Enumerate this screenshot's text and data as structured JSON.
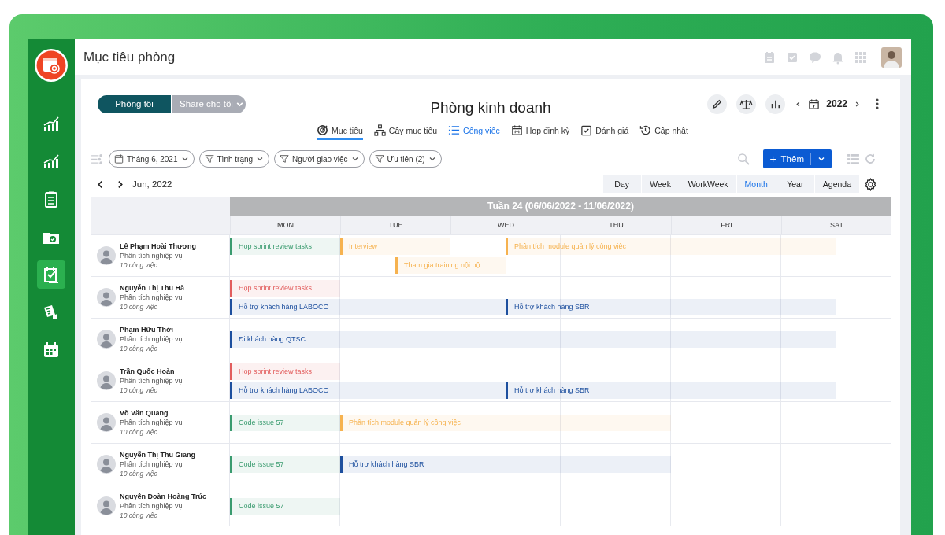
{
  "app": {
    "title": "Mục tiêu phòng"
  },
  "sidebar": {
    "items": [
      {
        "selected": false
      },
      {
        "selected": false
      },
      {
        "selected": false
      },
      {
        "selected": false
      },
      {
        "selected": true
      },
      {
        "selected": false
      },
      {
        "selected": false
      }
    ]
  },
  "scope_toggle": [
    {
      "label": "Phòng tôi",
      "selected": true
    },
    {
      "label": "Share cho tôi",
      "selected": false
    }
  ],
  "page_title": "Phòng kinh doanh",
  "year_nav": {
    "year": "2022"
  },
  "tabs": [
    {
      "label": "Mục tiêu",
      "selected": true,
      "current": false
    },
    {
      "label": "Cây mục tiêu",
      "selected": false,
      "current": false
    },
    {
      "label": "Công việc",
      "selected": false,
      "current": true
    },
    {
      "label": "Họp định kỳ",
      "selected": false,
      "current": false
    },
    {
      "label": "Đánh giá",
      "selected": false,
      "current": false
    },
    {
      "label": "Cập nhật",
      "selected": false,
      "current": false
    }
  ],
  "filters": [
    {
      "label": "Tháng 6, 2021",
      "kind": "date"
    },
    {
      "label": "Tình trạng",
      "kind": "filter"
    },
    {
      "label": "Người giao việc",
      "kind": "filter"
    },
    {
      "label": "Ưu tiên (2)",
      "kind": "filter"
    }
  ],
  "add_button": {
    "icon": "+",
    "label": "Thêm"
  },
  "month_label": "Jun, 2022",
  "views": [
    {
      "label": "Day",
      "selected": false
    },
    {
      "label": "Week",
      "selected": false
    },
    {
      "label": "WorkWeek",
      "selected": false
    },
    {
      "label": "Month",
      "selected": true
    },
    {
      "label": "Year",
      "selected": false
    },
    {
      "label": "Agenda",
      "selected": false
    }
  ],
  "calendar": {
    "week_title": "Tuần 24 (06/06/2022 - 11/06/2022)",
    "days": [
      "MON",
      "TUE",
      "WED",
      "THU",
      "FRI",
      "SAT"
    ],
    "people": [
      {
        "name": "Lê Phạm Hoài Thương",
        "role": "Phân tích nghiệp vụ",
        "count": "10 công việc",
        "lanes": [
          [
            {
              "kind": "start",
              "title": "Họp sprint review tasks",
              "color": "#3a9b6f"
            },
            {
              "kind": "continued"
            },
            {
              "kind": "start",
              "title": "Interview",
              "color": "#f6b24f"
            },
            {
              "kind": "continued"
            },
            {
              "kind": "empty"
            },
            {
              "kind": "start",
              "title": "Phân tích module quản lý công việc",
              "color": "#f6b24f"
            },
            {
              "kind": "continued"
            },
            {
              "kind": "continued"
            },
            {
              "kind": "continued"
            },
            {
              "kind": "continued"
            },
            {
              "kind": "continued"
            }
          ],
          [
            {
              "kind": "empty"
            },
            {
              "kind": "empty"
            },
            {
              "kind": "empty"
            },
            {
              "kind": "start",
              "title": "Tham gia training nội bộ",
              "color": "#f6b24f"
            },
            {
              "kind": "continued"
            }
          ]
        ]
      },
      {
        "name": "Nguyễn Thị Thu Hà",
        "role": "Phân tích nghiệp vụ",
        "count": "10 công việc",
        "lanes": [
          [
            {
              "kind": "start",
              "title": "Họp sprint review tasks",
              "color": "#e25d5d"
            },
            {
              "kind": "continued"
            }
          ],
          [
            {
              "kind": "start",
              "title": "Hỗ trợ khách hàng LABOCO",
              "color": "#1d4f9e"
            },
            {
              "kind": "continued"
            },
            {
              "kind": "continued"
            },
            {
              "kind": "continued"
            },
            {
              "kind": "continued"
            },
            {
              "kind": "start",
              "title": "Hỗ trợ khách hàng SBR",
              "color": "#1d4f9e"
            },
            {
              "kind": "continued"
            },
            {
              "kind": "continued"
            },
            {
              "kind": "continued"
            },
            {
              "kind": "continued"
            },
            {
              "kind": "continued"
            }
          ]
        ]
      },
      {
        "name": "Phạm Hữu Thời",
        "role": "Phân tích nghiệp vụ",
        "count": "10 công việc",
        "lanes": [
          [
            {
              "kind": "start",
              "title": "Đi khách hàng QTSC",
              "color": "#1d4f9e"
            },
            {
              "kind": "continued"
            },
            {
              "kind": "continued"
            },
            {
              "kind": "continued"
            },
            {
              "kind": "continued"
            },
            {
              "kind": "continued"
            },
            {
              "kind": "continued"
            },
            {
              "kind": "continued"
            },
            {
              "kind": "continued"
            },
            {
              "kind": "continued"
            },
            {
              "kind": "continued"
            }
          ]
        ]
      },
      {
        "name": "Trần Quốc Hoàn",
        "role": "Phân tích nghiệp vụ",
        "count": "10 công việc",
        "lanes": [
          [
            {
              "kind": "start",
              "title": "Họp sprint review tasks",
              "color": "#e25d5d"
            },
            {
              "kind": "continued"
            }
          ],
          [
            {
              "kind": "start",
              "title": "Hỗ trợ khách hàng LABOCO",
              "color": "#1d4f9e"
            },
            {
              "kind": "continued"
            },
            {
              "kind": "continued"
            },
            {
              "kind": "continued"
            },
            {
              "kind": "continued"
            },
            {
              "kind": "start",
              "title": "Hỗ trợ khách hàng SBR",
              "color": "#1d4f9e"
            },
            {
              "kind": "continued"
            },
            {
              "kind": "continued"
            },
            {
              "kind": "continued"
            },
            {
              "kind": "continued"
            },
            {
              "kind": "continued"
            }
          ]
        ]
      },
      {
        "name": "Võ Văn Quang",
        "role": "Phân tích nghiệp vụ",
        "count": "10 công việc",
        "lanes": [
          [
            {
              "kind": "start",
              "title": "Code issue 57",
              "color": "#3a9b6f"
            },
            {
              "kind": "continued"
            },
            {
              "kind": "start",
              "title": "Phân tích module quản lý công việc",
              "color": "#f6b24f"
            },
            {
              "kind": "continued"
            },
            {
              "kind": "continued"
            },
            {
              "kind": "continued"
            },
            {
              "kind": "continued"
            },
            {
              "kind": "continued"
            }
          ]
        ]
      },
      {
        "name": "Nguyễn Thị Thu Giang",
        "role": "Phân tích nghiệp vụ",
        "count": "10 công việc",
        "lanes": [
          [
            {
              "kind": "start",
              "title": "Code issue 57",
              "color": "#3a9b6f"
            },
            {
              "kind": "continued"
            },
            {
              "kind": "start",
              "title": "Hỗ trợ khách hàng SBR",
              "color": "#1d4f9e"
            },
            {
              "kind": "continued"
            },
            {
              "kind": "continued"
            },
            {
              "kind": "continued"
            },
            {
              "kind": "continued"
            },
            {
              "kind": "continued"
            }
          ]
        ]
      },
      {
        "name": "Nguyễn Đoàn Hoàng Trúc",
        "role": "Phân tích nghiệp vụ",
        "count": "10 công việc",
        "lanes": [
          [
            {
              "kind": "start",
              "title": "Code issue 57",
              "color": "#3a9b6f"
            },
            {
              "kind": "continued"
            }
          ]
        ]
      }
    ]
  }
}
